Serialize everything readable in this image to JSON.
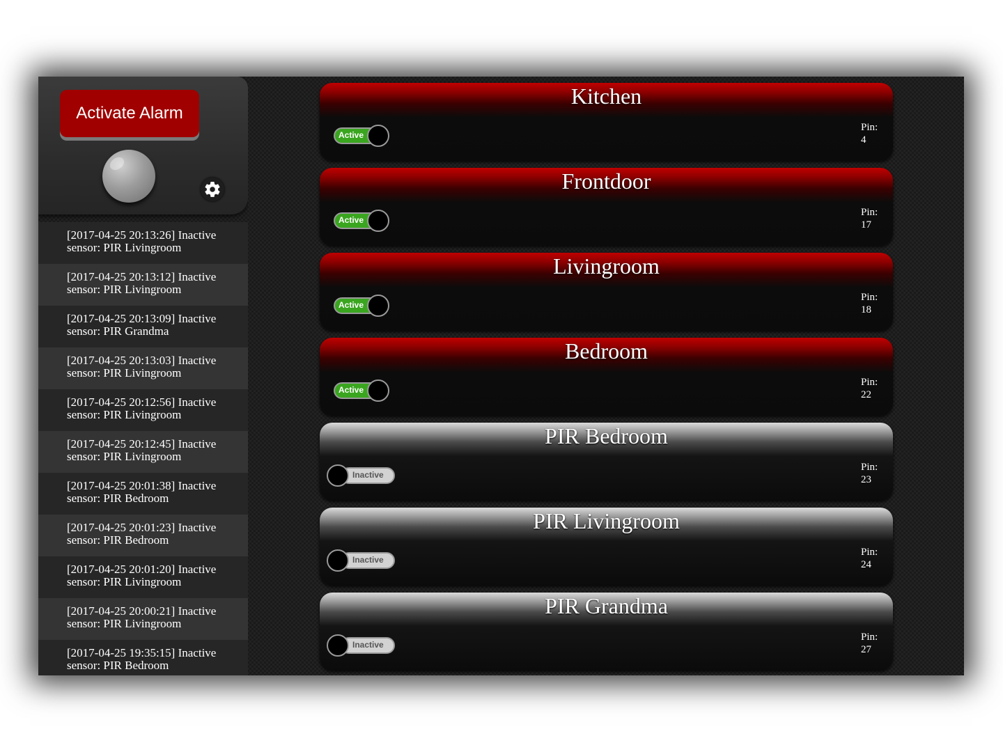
{
  "controls": {
    "alarm_button_label": "Activate Alarm",
    "settings_icon": "gear-icon",
    "status_light_color": "#9c9c9c"
  },
  "log": [
    {
      "line1": "[2017-04-25 20:13:26] Inactive",
      "line2": "sensor: PIR Livingroom"
    },
    {
      "line1": "[2017-04-25 20:13:12] Inactive",
      "line2": "sensor: PIR Livingroom"
    },
    {
      "line1": "[2017-04-25 20:13:09] Inactive",
      "line2": "sensor: PIR Grandma"
    },
    {
      "line1": "[2017-04-25 20:13:03] Inactive",
      "line2": "sensor: PIR Livingroom"
    },
    {
      "line1": "[2017-04-25 20:12:56] Inactive",
      "line2": "sensor: PIR Livingroom"
    },
    {
      "line1": "[2017-04-25 20:12:45] Inactive",
      "line2": "sensor: PIR Livingroom"
    },
    {
      "line1": "[2017-04-25 20:01:38] Inactive",
      "line2": "sensor: PIR Bedroom"
    },
    {
      "line1": "[2017-04-25 20:01:23] Inactive",
      "line2": "sensor: PIR Bedroom"
    },
    {
      "line1": "[2017-04-25 20:01:20] Inactive",
      "line2": "sensor: PIR Livingroom"
    },
    {
      "line1": "[2017-04-25 20:00:21] Inactive",
      "line2": "sensor: PIR Livingroom"
    },
    {
      "line1": "[2017-04-25 19:35:15] Inactive",
      "line2": "sensor: PIR Bedroom"
    }
  ],
  "sensors": [
    {
      "name": "Kitchen",
      "active": true,
      "status_label": "Active",
      "pin_label": "Pin:",
      "pin": "4"
    },
    {
      "name": "Frontdoor",
      "active": true,
      "status_label": "Active",
      "pin_label": "Pin:",
      "pin": "17"
    },
    {
      "name": "Livingroom",
      "active": true,
      "status_label": "Active",
      "pin_label": "Pin:",
      "pin": "18"
    },
    {
      "name": "Bedroom",
      "active": true,
      "status_label": "Active",
      "pin_label": "Pin:",
      "pin": "22"
    },
    {
      "name": "PIR Bedroom",
      "active": false,
      "status_label": "Inactive",
      "pin_label": "Pin:",
      "pin": "23"
    },
    {
      "name": "PIR Livingroom",
      "active": false,
      "status_label": "Inactive",
      "pin_label": "Pin:",
      "pin": "24"
    },
    {
      "name": "PIR Grandma",
      "active": false,
      "status_label": "Inactive",
      "pin_label": "Pin:",
      "pin": "27"
    }
  ],
  "colors": {
    "active_header": "#c00000",
    "inactive_header": "#dcdcdc",
    "toggle_on": "#3aa61f",
    "toggle_off": "#d2d2d2",
    "alarm_button": "#a00000"
  }
}
